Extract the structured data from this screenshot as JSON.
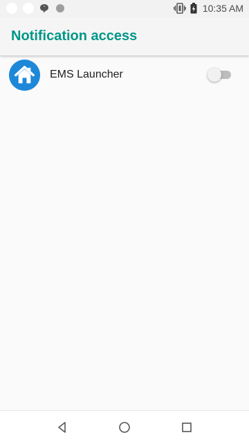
{
  "status_bar": {
    "time": "10:35 AM",
    "icons": [
      "notification-dot-icon",
      "notification-dot-icon",
      "chat-bubble-icon",
      "gray-dot-icon",
      "vibrate-icon",
      "battery-charging-icon"
    ]
  },
  "app_bar": {
    "title": "Notification access",
    "title_color": "#009688"
  },
  "list": {
    "items": [
      {
        "label": "EMS Launcher",
        "icon": "home-icon",
        "icon_color": "#1e88d8",
        "toggle_on": false
      }
    ]
  },
  "nav_bar": {
    "icons": [
      "back-icon",
      "home-circle-icon",
      "recents-icon"
    ]
  }
}
